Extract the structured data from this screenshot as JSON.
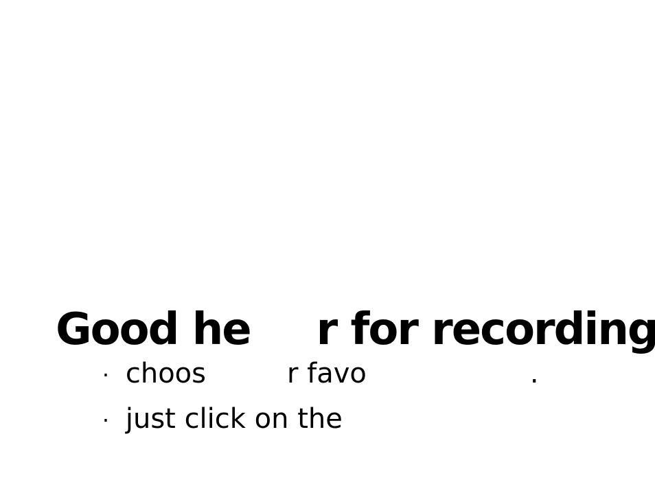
{
  "slide": {
    "title_part1": "Good he",
    "title_part2": "r for recording",
    "bullets": [
      {
        "marker": "·",
        "part1": "choos",
        "part2": "r favo",
        "part3": "."
      },
      {
        "marker": "·",
        "text": "just click on the"
      }
    ]
  }
}
